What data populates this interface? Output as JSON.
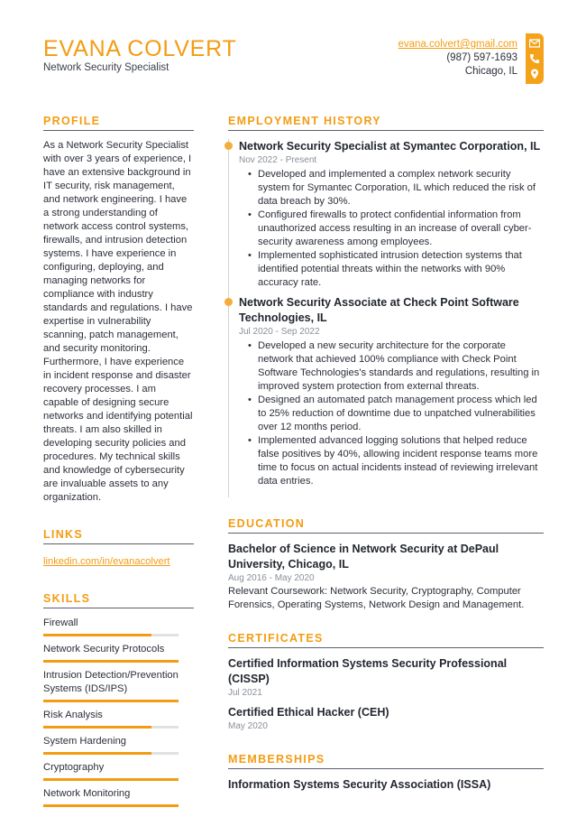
{
  "header": {
    "name": "EVANA COLVERT",
    "title": "Network Security Specialist"
  },
  "contact": {
    "email": "evana.colvert@gmail.com",
    "phone": "(987) 597-1693",
    "location": "Chicago, IL",
    "icons": [
      "envelope-icon",
      "phone-icon",
      "map-pin-icon"
    ],
    "accent_color": "#f39c12"
  },
  "profile": {
    "heading": "PROFILE",
    "text": "As a Network Security Specialist with over 3 years of experience, I have an extensive background in IT security, risk management, and network engineering. I have a strong understanding of network access control systems, firewalls, and intrusion detection systems. I have experience in configuring, deploying, and managing networks for compliance with industry standards and regulations. I have expertise in vulnerability scanning, patch management, and security monitoring. Furthermore, I have experience in incident response and disaster recovery processes. I am capable of designing secure networks and identifying potential threats. I am also skilled in developing security policies and procedures. My technical skills and knowledge of cybersecurity are invaluable assets to any organization."
  },
  "links": {
    "heading": "LINKS",
    "items": [
      {
        "label": "linkedin.com/in/evanacolvert"
      }
    ]
  },
  "skills": {
    "heading": "SKILLS",
    "items": [
      {
        "name": "Firewall",
        "level": 0.8
      },
      {
        "name": "Network Security Protocols",
        "level": 1.0
      },
      {
        "name": "Intrusion Detection/Prevention Systems (IDS/IPS)",
        "level": 1.0
      },
      {
        "name": "Risk Analysis",
        "level": 0.8
      },
      {
        "name": "System Hardening",
        "level": 0.8
      },
      {
        "name": "Cryptography",
        "level": 1.0
      },
      {
        "name": "Network Monitoring",
        "level": 1.0
      }
    ]
  },
  "employment": {
    "heading": "EMPLOYMENT HISTORY",
    "jobs": [
      {
        "title": "Network Security Specialist at Symantec Corporation, IL",
        "dates": "Nov 2022 - Present",
        "bullets": [
          "Developed and implemented a complex network security system for Symantec Corporation, IL which reduced the risk of data breach by 30%.",
          "Configured firewalls to protect confidential information from unauthorized access resulting in an increase of overall cyber-security awareness among employees.",
          "Implemented sophisticated intrusion detection systems that identified potential threats within the networks with 90% accuracy rate."
        ]
      },
      {
        "title": "Network Security Associate at Check Point Software Technologies, IL",
        "dates": "Jul 2020 - Sep 2022",
        "bullets": [
          "Developed a new security architecture for the corporate network that achieved 100% compliance with Check Point Software Technologies's standards and regulations, resulting in improved system protection from external threats.",
          "Designed an automated patch management process which led to 25% reduction of downtime due to unpatched vulnerabilities over 12 months period.",
          "Implemented advanced logging solutions that helped reduce false positives by 40%, allowing incident response teams more time to focus on actual incidents instead of reviewing irrelevant data entries."
        ]
      }
    ]
  },
  "education": {
    "heading": "EDUCATION",
    "items": [
      {
        "title": "Bachelor of Science in Network Security at DePaul University, Chicago, IL",
        "dates": "Aug 2016 - May 2020",
        "description": "Relevant Coursework: Network Security, Cryptography, Computer Forensics, Operating Systems, Network Design and Management."
      }
    ]
  },
  "certificates": {
    "heading": "CERTIFICATES",
    "items": [
      {
        "title": "Certified Information Systems Security Professional (CISSP)",
        "date": "Jul 2021"
      },
      {
        "title": "Certified Ethical Hacker (CEH)",
        "date": "May 2020"
      }
    ]
  },
  "memberships": {
    "heading": "MEMBERSHIPS",
    "items": [
      {
        "title": "Information Systems Security Association (ISSA)"
      }
    ]
  }
}
